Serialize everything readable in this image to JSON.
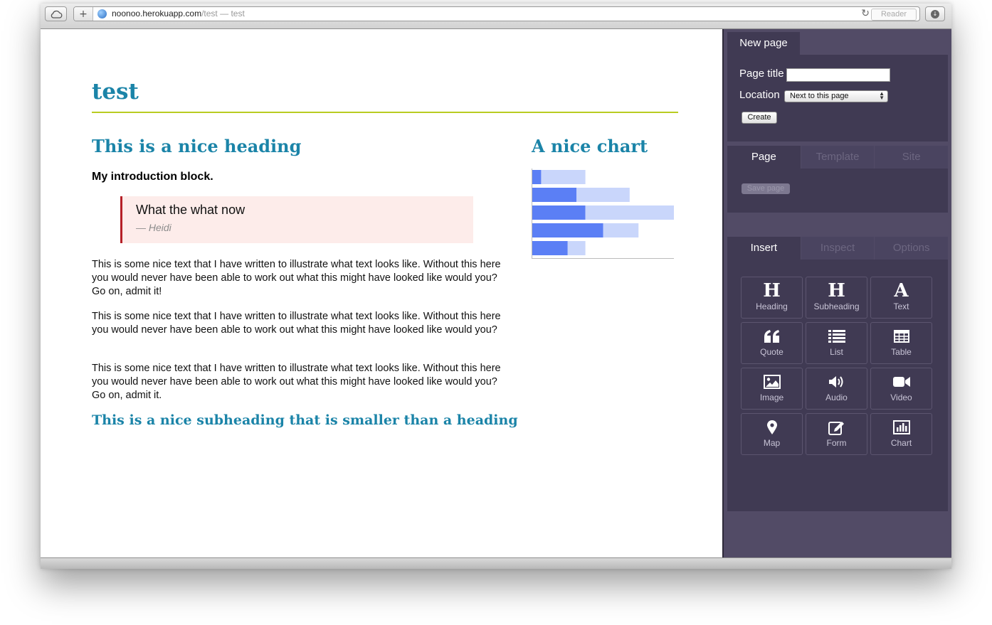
{
  "browser": {
    "url_host": "noonoo.herokuapp.com",
    "url_path": "/test",
    "url_title": " — test",
    "reader_label": "Reader"
  },
  "page": {
    "title": "test",
    "heading": "This is a nice heading",
    "intro": "My introduction block.",
    "quote": {
      "text": "What the what now",
      "cite": "— Heidi"
    },
    "paragraphs": [
      "This is some nice text that I have written to illustrate what text looks like. Without this here you would never have been able to work out what this might have looked like would you? Go on, admit it!",
      "This is some nice text that I have written to illustrate what text looks like. Without this here you would never have been able to work out what this might have looked like would you?",
      "This is some nice text that I have written to illustrate what text looks like. Without this here you would never have been able to work out what this might have looked like would you? Go on, admit it."
    ],
    "subheading": "This is a nice subheading that is smaller than a heading",
    "chart_title": "A nice chart"
  },
  "chart_data": {
    "type": "bar",
    "orientation": "horizontal",
    "stacked": true,
    "categories": [
      "",
      "",
      "",
      "",
      ""
    ],
    "series": [
      {
        "values": [
          1,
          5,
          6,
          8,
          4
        ],
        "color": "#5b7ff5"
      },
      {
        "values": [
          5,
          6,
          10,
          4,
          2
        ],
        "color": "#c9d6fb"
      }
    ],
    "xlim": [
      0,
      16
    ],
    "axes_labels": "none"
  },
  "sidebar": {
    "new_page": {
      "tab_label": "New page",
      "title_label": "Page title",
      "title_value": "",
      "location_label": "Location",
      "location_value": "Next to this page",
      "create_label": "Create"
    },
    "page_tabs": [
      "Page",
      "Template",
      "Site"
    ],
    "save_label": "Save page",
    "insert_tabs": [
      "Insert",
      "Inspect",
      "Options"
    ],
    "insert_items": [
      {
        "label": "Heading",
        "icon": "heading-icon"
      },
      {
        "label": "Subheading",
        "icon": "subheading-icon"
      },
      {
        "label": "Text",
        "icon": "text-icon"
      },
      {
        "label": "Quote",
        "icon": "quote-icon"
      },
      {
        "label": "List",
        "icon": "list-icon"
      },
      {
        "label": "Table",
        "icon": "table-icon"
      },
      {
        "label": "Image",
        "icon": "image-icon"
      },
      {
        "label": "Audio",
        "icon": "audio-icon"
      },
      {
        "label": "Video",
        "icon": "video-icon"
      },
      {
        "label": "Map",
        "icon": "map-icon"
      },
      {
        "label": "Form",
        "icon": "form-icon"
      },
      {
        "label": "Chart",
        "icon": "chart-icon"
      }
    ]
  },
  "colors": {
    "accent": "#1b84a8",
    "rule": "#b9cc21",
    "quote_bg": "#fdecea",
    "quote_border": "#b52027",
    "sidebar_bg": "#524b66",
    "panel_bg": "#403a53"
  }
}
